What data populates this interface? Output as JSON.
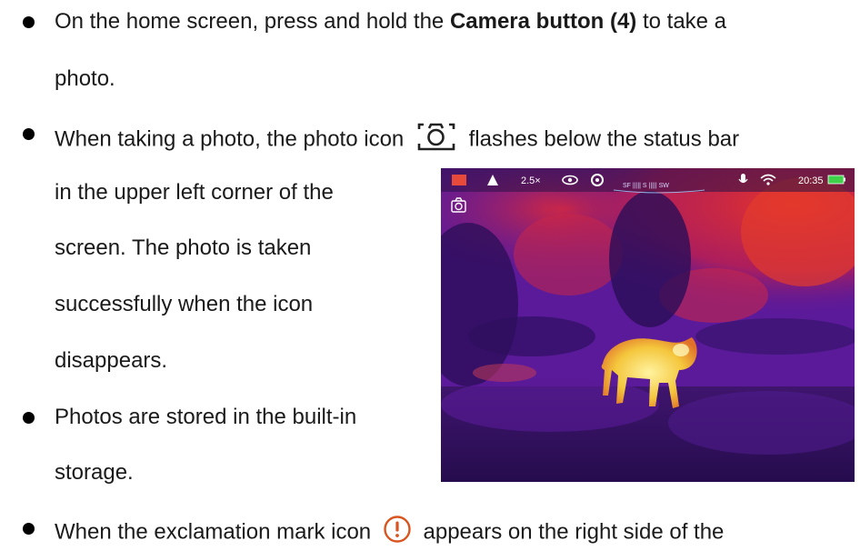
{
  "bullet1": {
    "line1_pre": "On the home screen, press and hold the ",
    "line1_bold": "Camera button (4)",
    "line1_post": " to take a",
    "line2": "photo."
  },
  "bullet2": {
    "line1_pre": "When taking a photo, the photo icon",
    "line1_post": "flashes below the status bar",
    "line2": "in the upper left corner of the",
    "line3": "screen. The photo is taken",
    "line4": "successfully when the icon",
    "line5": "disappears."
  },
  "bullet3": {
    "line1": "Photos are stored in the built-in",
    "line2": "storage."
  },
  "bullet4": {
    "line1_pre": "When the exclamation mark icon",
    "line1_post": "appears on the right side of the"
  },
  "thermal_image": {
    "status_bar": {
      "zoom": "2.5×",
      "mode_label": "SF ||||| S ||||| SW",
      "time": "20:35"
    },
    "icons": [
      "palette-icon",
      "brightness-icon",
      "eye-icon",
      "settings-icon",
      "microphone-icon",
      "wifi-icon",
      "battery-icon",
      "camera-icon"
    ]
  },
  "colors": {
    "text": "#1a1a1a",
    "icon_camera_stroke": "#222222",
    "icon_warning": "#d9541e",
    "thermal_bg": "#5b1a9a",
    "thermal_hot": "#f2d24a"
  }
}
